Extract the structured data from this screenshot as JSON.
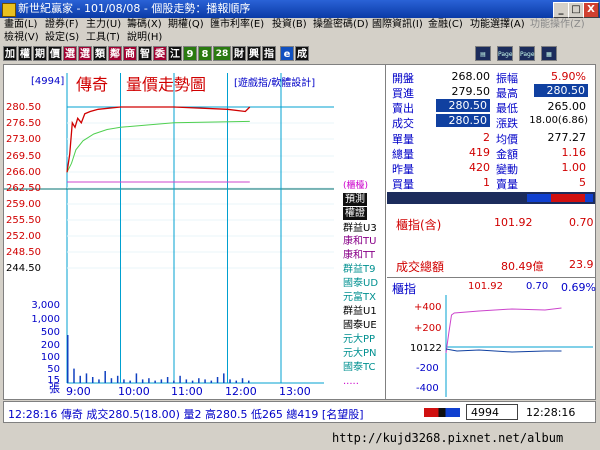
{
  "window": {
    "title": "新世紀贏家 - 101/08/08 - 個股走勢：播報順序",
    "min_label": "_",
    "max_label": "□",
    "close_label": "X"
  },
  "menu1": [
    {
      "label": "畫面(L)",
      "enabled": true
    },
    {
      "label": "證券(F)",
      "enabled": true
    },
    {
      "label": "主力(U)",
      "enabled": true
    },
    {
      "label": "籌碼(X)",
      "enabled": true
    },
    {
      "label": "期權(Q)",
      "enabled": true
    },
    {
      "label": "匯市利率(E)",
      "enabled": true
    },
    {
      "label": "投資(B)",
      "enabled": true
    },
    {
      "label": "操盤密碼(D)",
      "enabled": true
    },
    {
      "label": "國際資訊(I)",
      "enabled": true
    },
    {
      "label": "金融(C)",
      "enabled": true
    },
    {
      "label": "功能選擇(A)",
      "enabled": true
    },
    {
      "label": "功能操作(Z)",
      "enabled": false
    }
  ],
  "menu2": [
    {
      "label": "檢視(V)",
      "enabled": true
    },
    {
      "label": "設定(S)",
      "enabled": true
    },
    {
      "label": "工具(T)",
      "enabled": true
    },
    {
      "label": "說明(H)",
      "enabled": true
    }
  ],
  "toolbar": {
    "buttons": [
      "加",
      "權",
      "期",
      "價",
      "選",
      "選",
      "類",
      "鄰",
      "商",
      "智",
      "委",
      "江",
      "9",
      "8",
      "28",
      "財",
      "興",
      "指",
      "e",
      "成"
    ],
    "icon_labels": [
      "Page",
      "Page"
    ]
  },
  "stock": {
    "code": "[4994]",
    "name": "傳奇",
    "chart_title": "量價走勢圖",
    "link": "[遊戲指/軟體設計]"
  },
  "quote": {
    "open_label": "開盤",
    "open": "268.00",
    "amp_label": "振幅",
    "amp": "5.90%",
    "bid_label": "買進",
    "bid": "279.50",
    "high_label": "最高",
    "high": "280.50",
    "ask_label": "賣出",
    "ask": "280.50",
    "low_label": "最低",
    "low": "265.00",
    "last_label": "成交",
    "last": "280.50",
    "change_label": "漲跌",
    "change": "18.00(6.86)",
    "unit_label": "單量",
    "unit": "2",
    "avg_label": "均價",
    "avg": "277.27",
    "total_label": "總量",
    "total": "419",
    "amount_label": "金額",
    "amount": "1.16",
    "yvol_label": "昨量",
    "yvol": "420",
    "vchg_label": "變動",
    "vchg": "1.00",
    "buyvol_label": "買量",
    "buyvol": "1",
    "sellvol_label": "賣量",
    "sellvol": "5"
  },
  "index_info": {
    "label": "櫃指(含)",
    "value": "101.92",
    "change": "0.70",
    "turnover_label": "成交總額",
    "turnover": "80.49億",
    "turnover_chg": "23.9"
  },
  "index_chart": {
    "label": "櫃指",
    "value": "101.92",
    "change": "0.70",
    "pct": "0.69%",
    "ticks": [
      "+400",
      "+200",
      "10122",
      "-200",
      "-400"
    ]
  },
  "price_axis": [
    "280.50",
    "276.50",
    "273.00",
    "269.50",
    "266.00",
    "262.50",
    "259.00",
    "255.50",
    "252.00",
    "248.50",
    "244.50"
  ],
  "volume_axis": [
    "3,000",
    "1,000",
    "500",
    "200",
    "100",
    "50",
    "15"
  ],
  "volume_unit": "張",
  "time_axis": [
    "9:00",
    "10:00",
    "11:00",
    "12:00",
    "13:00"
  ],
  "broker_header": "(櫃檯)",
  "brokers": [
    {
      "name": "預測",
      "style": "header"
    },
    {
      "name": "權證",
      "style": "header"
    },
    {
      "name": "群益U3",
      "color": "#000000"
    },
    {
      "name": "康和TU",
      "color": "#880088"
    },
    {
      "name": "康和TT",
      "color": "#880088"
    },
    {
      "name": "群益T9",
      "color": "#009090"
    },
    {
      "name": "國泰UD",
      "color": "#009090"
    },
    {
      "name": "元富TX",
      "color": "#009090"
    },
    {
      "name": "群益U1",
      "color": "#000000"
    },
    {
      "name": "國泰UE",
      "color": "#000000"
    },
    {
      "name": "元大PP",
      "color": "#009090"
    },
    {
      "name": "元大PN",
      "color": "#009090"
    },
    {
      "name": "國泰TC",
      "color": "#009090"
    },
    {
      "name": ".....",
      "color": "#cc00cc"
    }
  ],
  "status": {
    "ticker": "12:28:16 傳奇 成交280.5(18.00) 量2 高280.5 低265 總419 [名望股]",
    "code": "4994",
    "time": "12:28:16"
  },
  "url": "http://kujd3268.pixnet.net/album",
  "colors": {
    "price_line": "#d00000",
    "avg_line": "#50d050",
    "ref_line": "#cc44cc",
    "grid": "#00a0d0",
    "up": "#d00000",
    "accent": "#0000c8"
  }
}
